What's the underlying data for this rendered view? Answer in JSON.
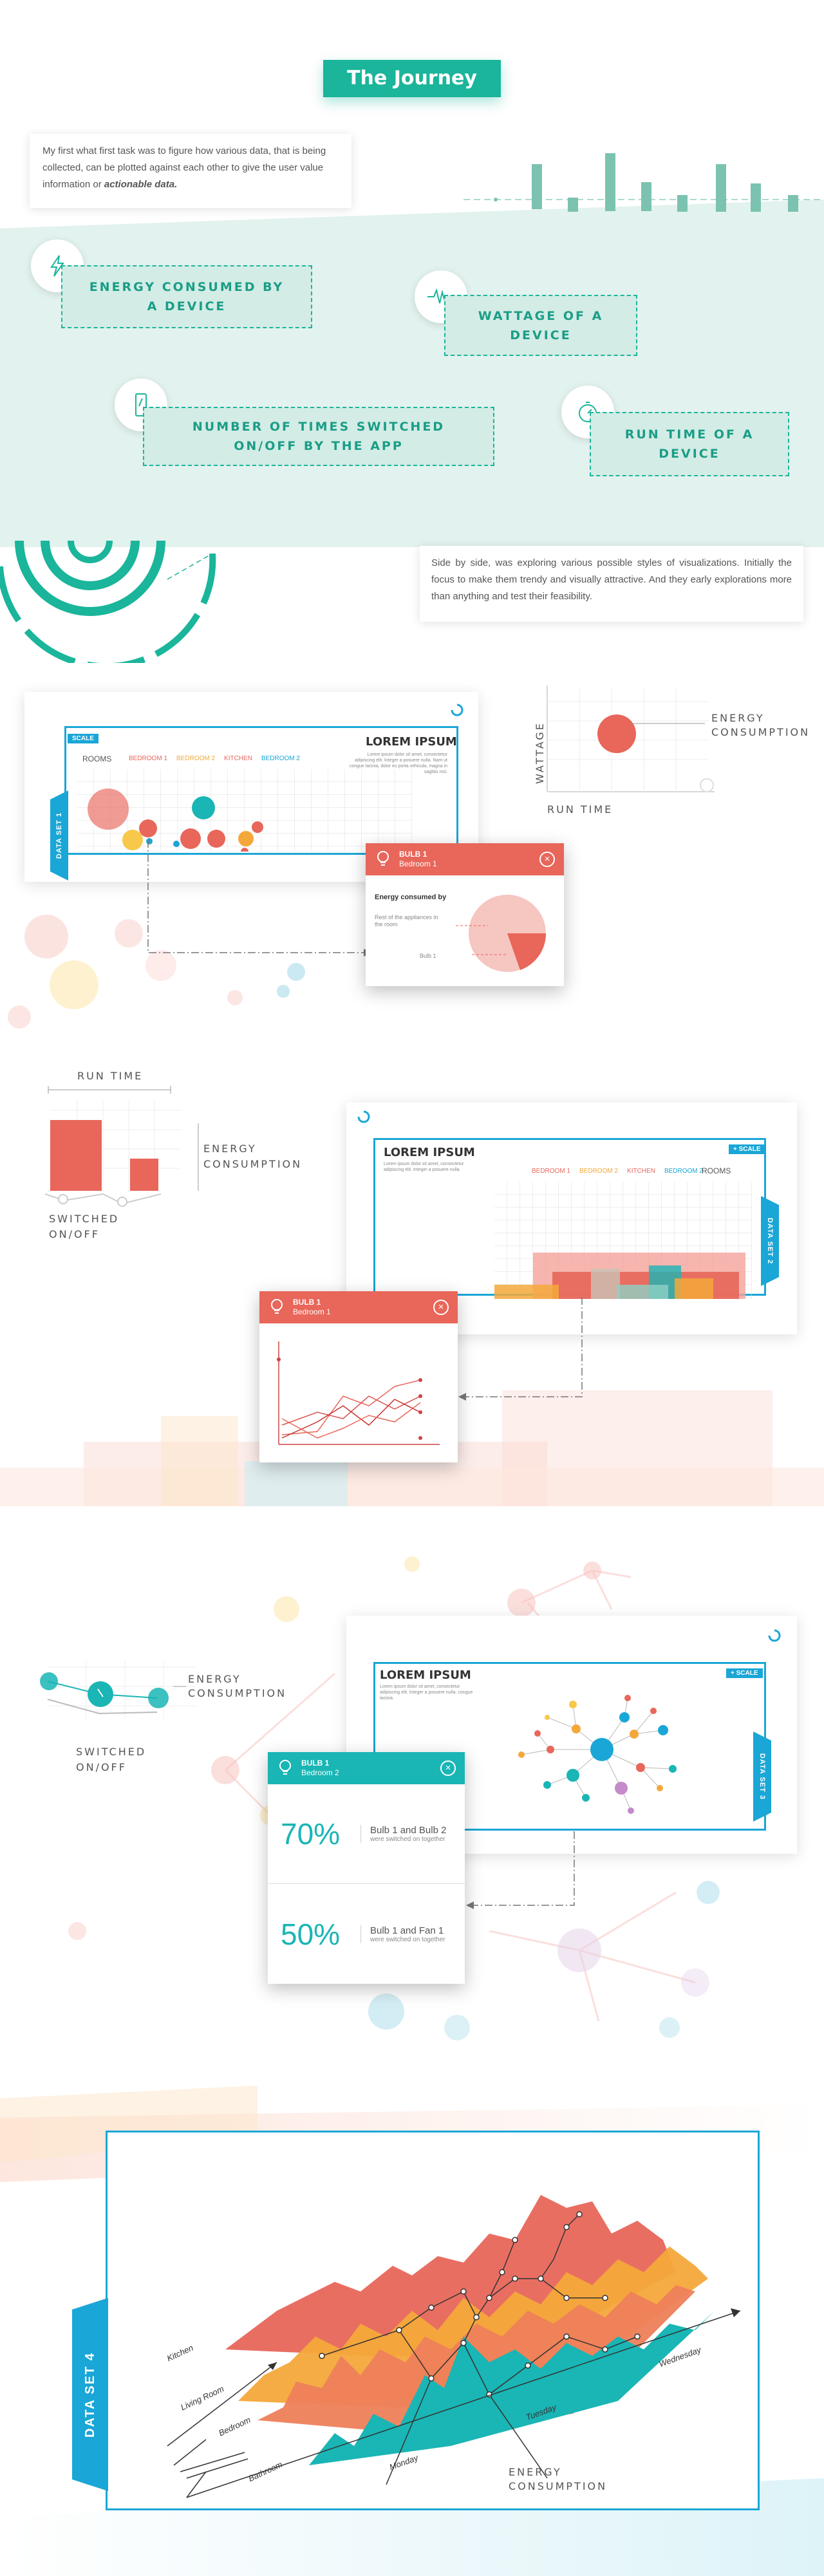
{
  "header": {
    "title": "The Journey"
  },
  "intro": {
    "text_lead": "My first what first task was to figure how various data, that is being collected, can be plotted against each other to give the user value information or ",
    "text_emphasis": "actionable data."
  },
  "metrics": [
    {
      "label": "ENERGY CONSUMED BY A DEVICE",
      "icon": "lightning-icon"
    },
    {
      "label": "WATTAGE OF A DEVICE",
      "icon": "waveform-icon"
    },
    {
      "label": "NUMBER OF TIMES SWITCHED ON/OFF BY THE APP",
      "icon": "phone-icon"
    },
    {
      "label": "RUN TIME OF A DEVICE",
      "icon": "timer-icon"
    }
  ],
  "exploration": {
    "text": "Side by side, was exploring various possible styles of visualizations. Initially the focus to make them trendy and visually attractive. And they early explorations more than anything and test their feasibility."
  },
  "colors": {
    "teal": "#1ab59a",
    "blue": "#1aa6d6",
    "coral": "#e8665a",
    "orange": "#f4a83a",
    "yellow": "#f7c84a",
    "mint_bg": "#e2f2ee"
  },
  "dataset1": {
    "tab": "DATA SET 1",
    "scale": "SCALE",
    "title": "LOREM IPSUM",
    "rooms_label": "ROOMS",
    "filters": [
      "BEDROOM 1",
      "BEDROOM 2",
      "KITCHEN",
      "BEDROOM 2"
    ],
    "desc": "Lorem ipsum dolor sit amet, consectetur adipiscing elit. Integer a posuere nulla. Nam ut congue lacinia, dolor eu porta vehicula, magna in sagittis nisl.",
    "sketch": {
      "y_label": "WATTAGE",
      "x_label": "RUN TIME",
      "annotation": "ENERGY CONSUMPTION"
    },
    "popup": {
      "title": "BULB 1",
      "subtitle": "Bedroom 1",
      "heading": "Energy consumed by",
      "rest_label": "Rest of the appliances in the room",
      "bulb_label": "Bulb 1"
    }
  },
  "dataset2": {
    "tab": "DATA SET 2",
    "scale": "+ SCALE",
    "title": "LOREM IPSUM",
    "rooms_label": "ROOMS",
    "filters": [
      "BEDROOM 1",
      "BEDROOM 2",
      "KITCHEN",
      "BEDROOM 2"
    ],
    "desc": "Lorem ipsum dolor sit amet, consectetur adipiscing elit. Integer a posuere nulla.",
    "sketch": {
      "top_label": "RUN TIME",
      "right_label": "ENERGY CONSUMPTION",
      "bottom_label": "SWITCHED ON/OFF"
    },
    "popup": {
      "title": "BULB 1",
      "subtitle": "Bedroom 1"
    }
  },
  "dataset3": {
    "tab": "DATA SET 3",
    "scale": "+ SCALE",
    "title": "LOREM IPSUM",
    "desc": "Lorem ipsum dolor sit amet, consectetur adipiscing elit. Integer a posuere nulla, congue lacinia.",
    "sketch": {
      "right_label": "ENERGY CONSUMPTION",
      "bottom_label": "SWITCHED ON/OFF"
    },
    "popup": {
      "title": "BULB 1",
      "subtitle": "Bedroom 2",
      "stats": [
        {
          "value": "70%",
          "label": "Bulb 1 and Bulb 2",
          "sub": "were switched on together"
        },
        {
          "value": "50%",
          "label": "Bulb 1 and Fan 1",
          "sub": "were switched on together"
        }
      ]
    }
  },
  "dataset4": {
    "tab": "DATA SET 4",
    "rooms": [
      "Kitchen",
      "Living Room",
      "Bedroom",
      "Bathroom"
    ],
    "days": [
      "Monday",
      "Tuesday",
      "Wednesday"
    ],
    "annotation": "ENERGY CONSUMPTION"
  }
}
